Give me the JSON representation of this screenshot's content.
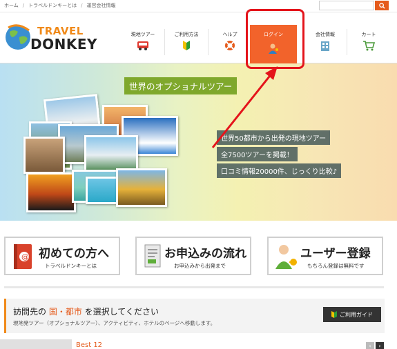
{
  "breadcrumb": [
    "ホーム",
    "トラベルドンキーとは",
    "運営会社情報"
  ],
  "search": {
    "placeholder": ""
  },
  "logo": {
    "line1": "TRAVEL",
    "line2": "DONKEY"
  },
  "nav": [
    {
      "label": "現地ツアー",
      "icon": "bus-icon"
    },
    {
      "label": "ご利用方法",
      "icon": "beginner-mark-icon"
    },
    {
      "label": "ヘルプ",
      "icon": "lifebuoy-icon"
    },
    {
      "label": "ログイン",
      "icon": "user-key-icon"
    },
    {
      "label": "会社情報",
      "icon": "building-icon"
    },
    {
      "label": "カート",
      "icon": "cart-icon"
    }
  ],
  "hero": {
    "title": "世界のオプショナルツアー",
    "tags": [
      "世界50都市から出発の現地ツアー",
      "全7500ツアーを掲載！",
      "口コミ情報20000件、じっくり比較♪"
    ]
  },
  "features": [
    {
      "title": "初めての方へ",
      "subtitle": "トラベルドンキーとは",
      "icon": "address-book-icon"
    },
    {
      "title": "お申込みの流れ",
      "subtitle": "お申込みから出発まで",
      "icon": "document-icon"
    },
    {
      "title": "ユーザー登録",
      "subtitle": "もちろん登録は無料です",
      "icon": "user-register-icon"
    }
  ],
  "destination": {
    "title_prefix": "訪問先の ",
    "title_highlight": "国・都市",
    "title_suffix": " を選択してください",
    "subtitle": "現地発ツアー（オプショナルツアー）、アクティビティ、ホテルのページへ移動します。",
    "guide_button": "ご利用ガイド"
  },
  "best_label": "Best 12",
  "colors": {
    "accent": "#e55b1c",
    "login_bg": "#f2632b",
    "highlight": "#e4141b",
    "hero_title_bg": "#7fa82c"
  }
}
